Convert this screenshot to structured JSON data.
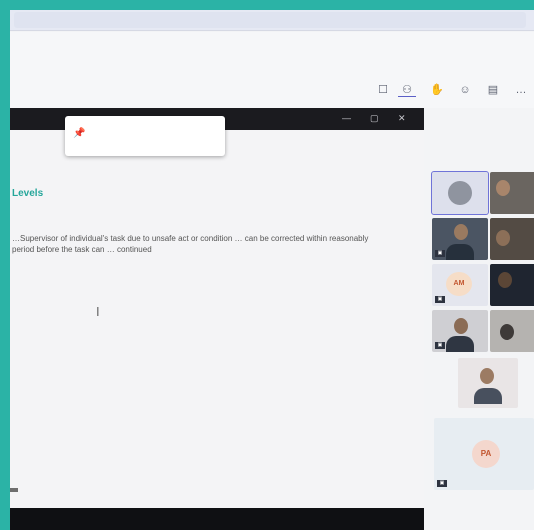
{
  "browser": {
    "url": ""
  },
  "toolbar": {
    "buttons": [
      {
        "name": "chat-icon",
        "glyph": "☐",
        "label": ""
      },
      {
        "name": "people-icon",
        "glyph": "⚇",
        "label": ""
      },
      {
        "name": "raise-hand-icon",
        "glyph": "✋",
        "label": ""
      },
      {
        "name": "react-icon",
        "glyph": "☺",
        "label": ""
      },
      {
        "name": "view-icon",
        "glyph": "▤",
        "label": ""
      },
      {
        "name": "more-icon",
        "glyph": "…",
        "label": ""
      }
    ]
  },
  "popup": {
    "pin_glyph": "📌",
    "title": "",
    "body": ""
  },
  "document": {
    "heading": "Levels",
    "body": "…Supervisor of individual's task due to unsafe act or condition … can be corrected within reasonably period before the task can … continued"
  },
  "caption": "",
  "gallery": {
    "avatar_initials": "AM",
    "large_avatar_initials": "PA",
    "badge": "▣"
  },
  "colors": {
    "accent": "#5b5fc7",
    "heading": "#25a69a",
    "frame": "#2bb3a6"
  }
}
